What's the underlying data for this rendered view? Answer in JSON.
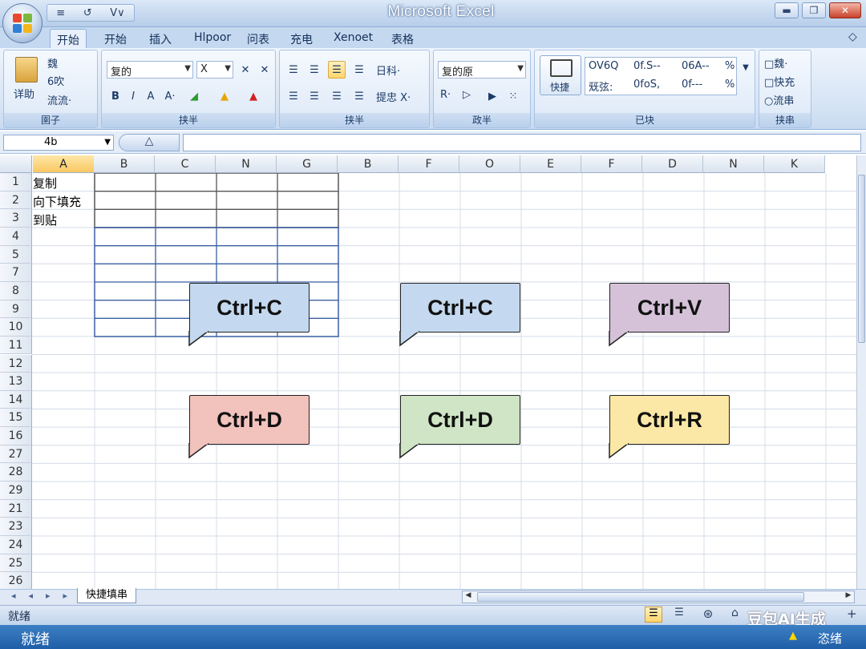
{
  "window": {
    "title": "Microsoft Excel",
    "qat": [
      "≡",
      "↺",
      "V∨"
    ],
    "buttons": {
      "minimize": "▬",
      "restore": "❐",
      "close": "✕"
    },
    "colors": {
      "titlebar": "#b6cde9",
      "close": "#c8412b"
    }
  },
  "tabs": [
    "开始",
    "开始",
    "插入",
    "Hlpoor",
    "问表",
    "充电",
    "Xenoet",
    "表格"
  ],
  "ribbon": {
    "collapse_icon": "◇",
    "groups": [
      {
        "label": "圉子",
        "big_button": "详助",
        "items": [
          "魏",
          "6吹",
          "流流·"
        ]
      },
      {
        "label": "挟半",
        "font_name": "复的",
        "font_size": "X",
        "format_buttons": [
          "B",
          "I",
          "A",
          "A·"
        ]
      },
      {
        "label": "挟半",
        "align_items": [
          "日科·",
          "提忠 X·"
        ]
      },
      {
        "label": "政半",
        "number_format": "复的原",
        "items": [
          "R·",
          "▷"
        ]
      },
      {
        "label": "已块",
        "big_button": "快捷",
        "styles_row1": [
          "OV6Q",
          "0f.S--",
          "06A--",
          "%"
        ],
        "styles_row2": [
          "兓弦:",
          "0foS,",
          "0f---",
          "%"
        ]
      },
      {
        "label": "挟串",
        "items": [
          "□魏·",
          "□快充",
          "○流串"
        ]
      }
    ]
  },
  "formula_bar": {
    "name_box": "4b",
    "fx_icon": "△",
    "content": ""
  },
  "grid": {
    "columns": [
      "A",
      "B",
      "C",
      "N",
      "G",
      "B",
      "F",
      "O",
      "E",
      "F",
      "D",
      "N",
      "K"
    ],
    "selected_column": "A",
    "rows": [
      "1",
      "2",
      "3",
      "4",
      "5",
      "7",
      "8",
      "9",
      "10",
      "11",
      "12",
      "13",
      "14",
      "15",
      "16",
      "27",
      "28",
      "29",
      "21",
      "23",
      "24",
      "25",
      "26"
    ],
    "cells_a": [
      "复制",
      "向下填充",
      "到贴"
    ]
  },
  "callouts": [
    {
      "text": "Ctrl+C",
      "color": "#c4d9ef"
    },
    {
      "text": "Ctrl+C",
      "color": "#c4d9ef"
    },
    {
      "text": "Ctrl+V",
      "color": "#d5c2d9"
    },
    {
      "text": "Ctrl+D",
      "color": "#f2c2bd"
    },
    {
      "text": "Ctrl+D",
      "color": "#cfe5c5"
    },
    {
      "text": "Ctrl+R",
      "color": "#fbe8a6"
    }
  ],
  "sheet": {
    "nav": [
      "◂",
      "◂",
      "▸",
      "▸"
    ],
    "tab_name": "快捷填串"
  },
  "status": {
    "left": "就绪",
    "taskbar_left": "就绪",
    "taskbar_right": "恣绪",
    "watermark": "豆包AI生成"
  }
}
